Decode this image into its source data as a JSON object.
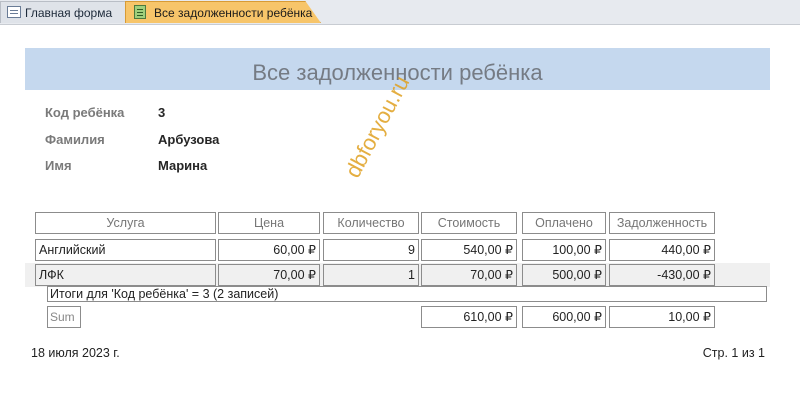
{
  "tabs": [
    {
      "label": "Главная форма",
      "icon": "form-icon"
    },
    {
      "label": "Все задолженности ребёнка",
      "icon": "report-icon",
      "active": true
    }
  ],
  "report": {
    "title": "Все задолженности ребёнка",
    "fields": [
      {
        "label": "Код ребёнка",
        "value": "3"
      },
      {
        "label": "Фамилия",
        "value": "Арбузова"
      },
      {
        "label": "Имя",
        "value": "Марина"
      }
    ],
    "columns": [
      "Услуга",
      "Цена",
      "Количество",
      "Стоимость",
      "Оплачено",
      "Задолженность"
    ],
    "rows": [
      [
        "Английский",
        "60,00 ₽",
        "9",
        "540,00 ₽",
        "100,00 ₽",
        "440,00 ₽"
      ],
      [
        "ЛФК",
        "70,00 ₽",
        "1",
        "70,00 ₽",
        "500,00 ₽",
        "-430,00 ₽"
      ]
    ],
    "group_summary": "Итоги для 'Код ребёнка' =  3 (2 записей)",
    "sum_label": "Sum",
    "sums": {
      "cost": "610,00 ₽",
      "paid": "600,00 ₽",
      "debt": "10,00 ₽"
    },
    "date": "18 июля 2023 г.",
    "page": "Стр. 1 из 1"
  },
  "watermark": "dbforyou.ru",
  "colors": {
    "title_band": "#c5d8ee",
    "active_tab": "#f7c56a",
    "watermark": "#e0a020"
  }
}
